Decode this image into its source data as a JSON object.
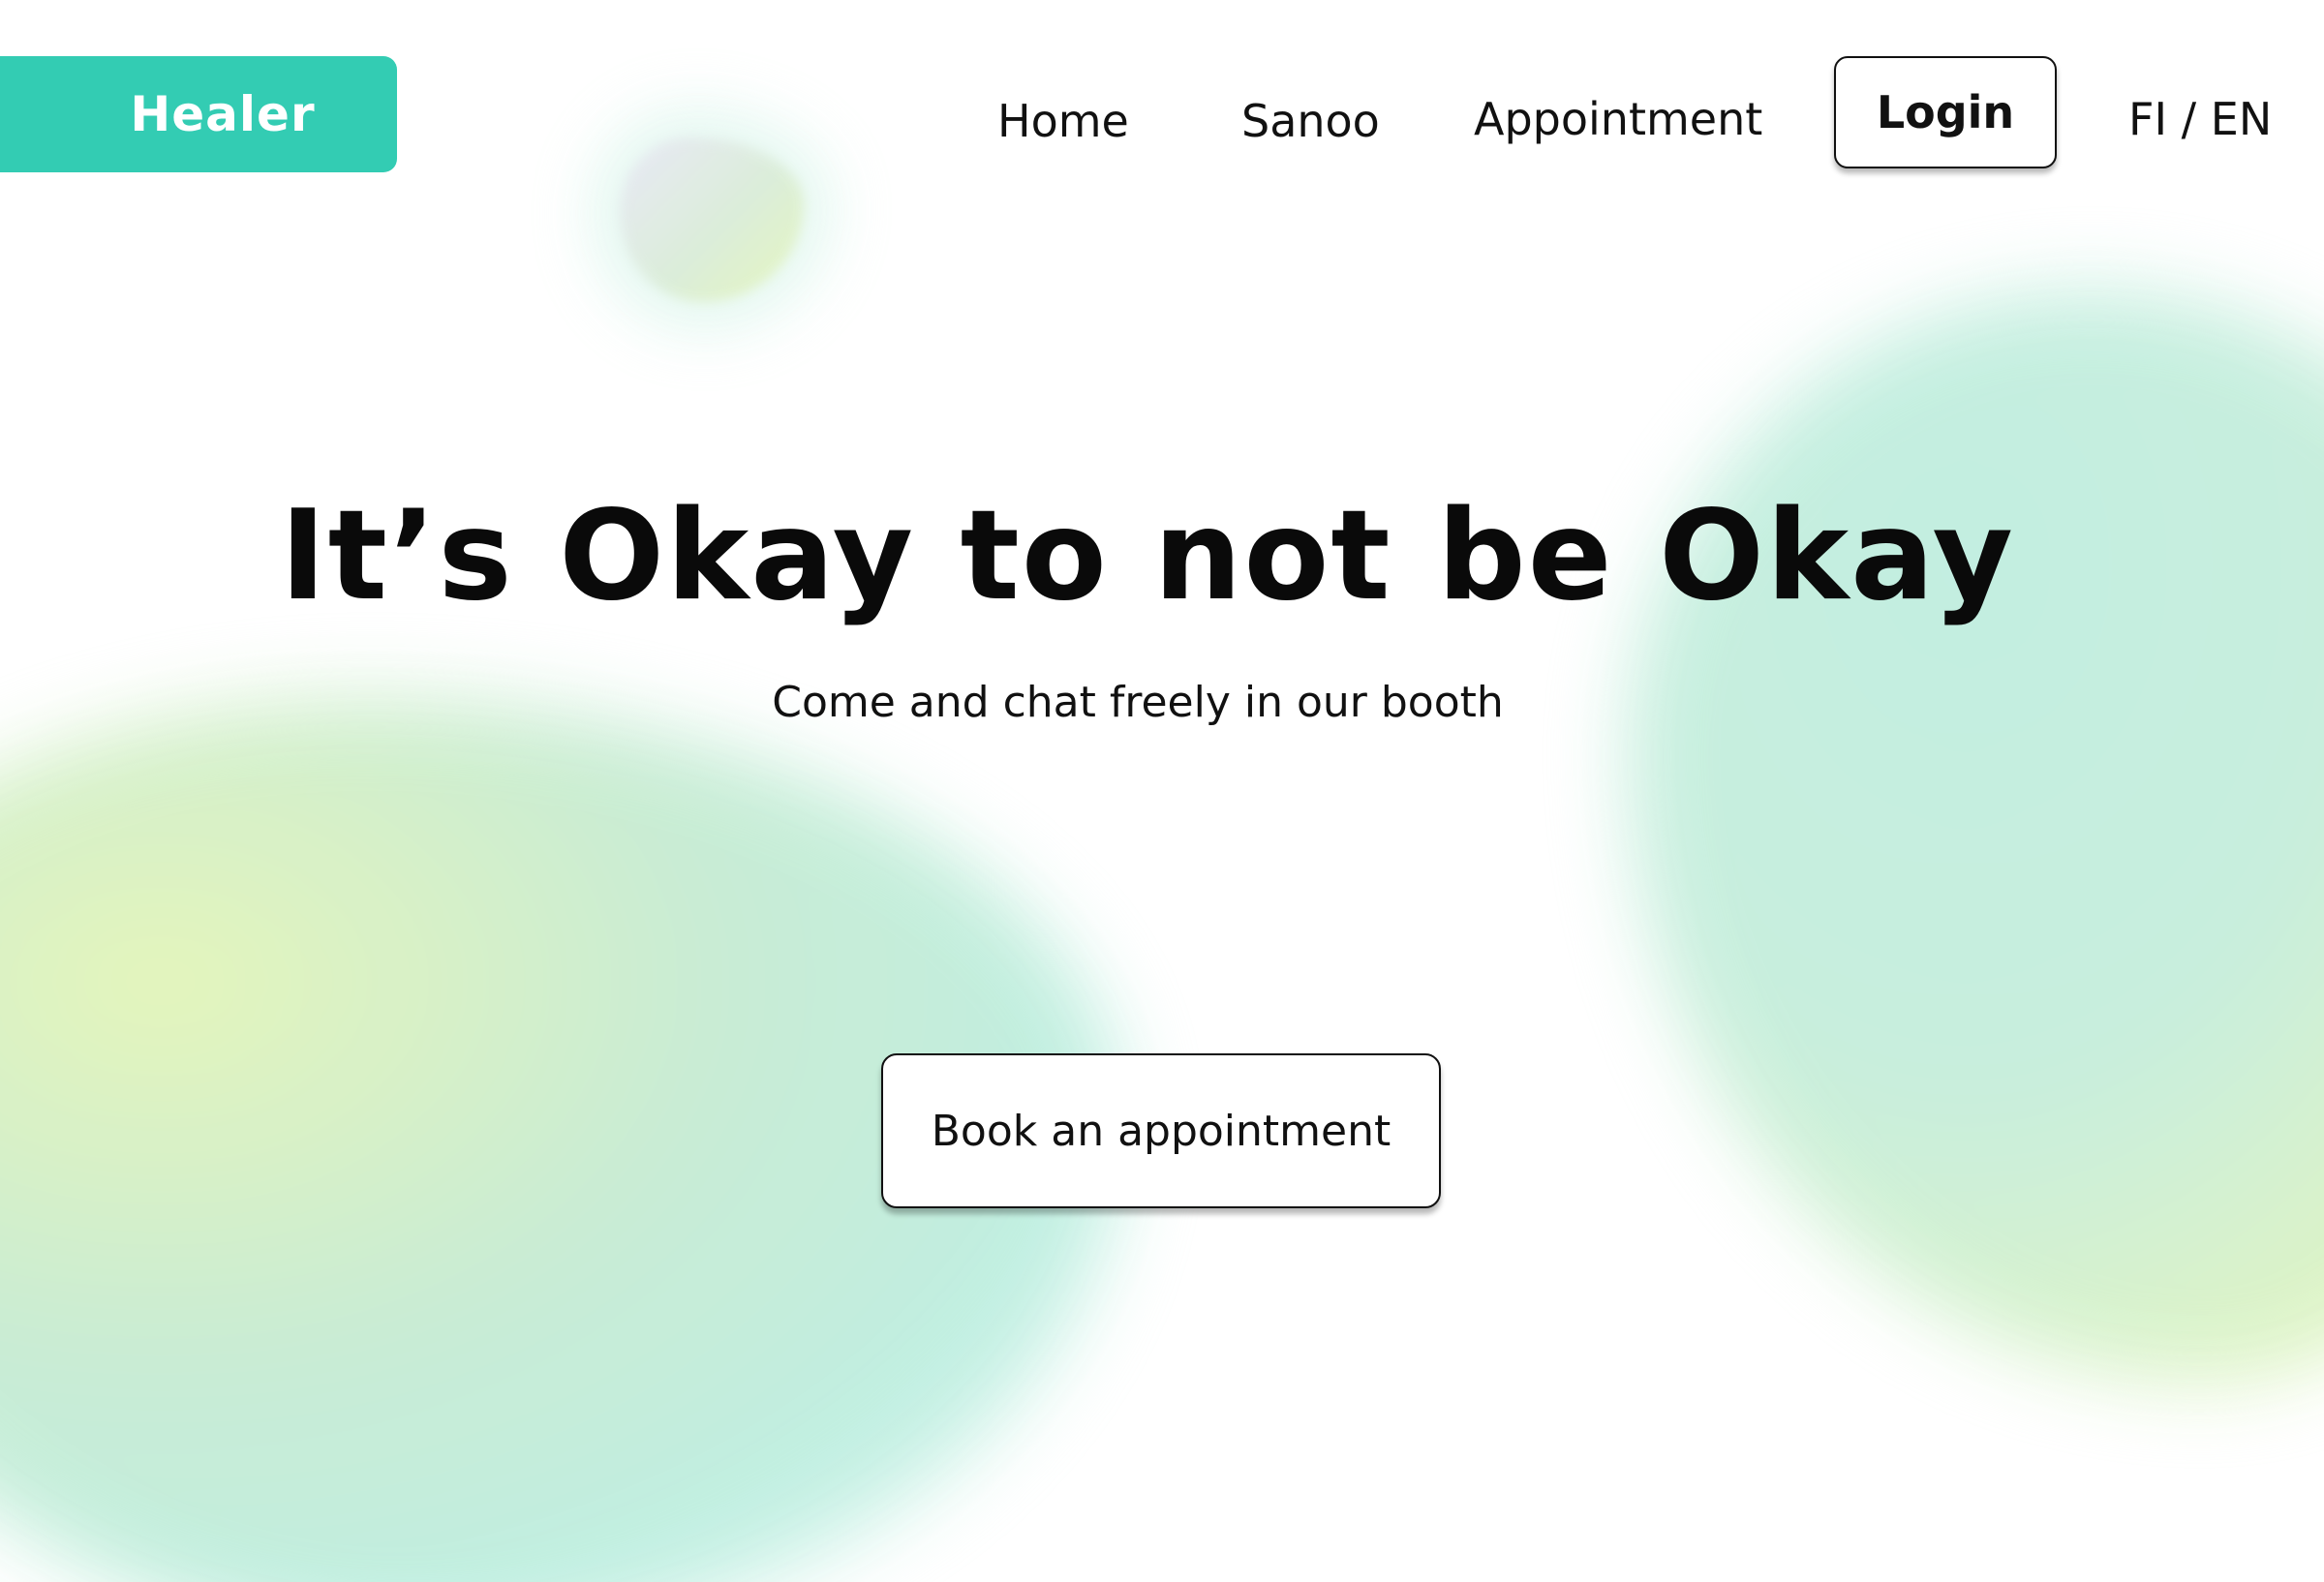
{
  "brand": {
    "name": "Healer",
    "accent_color": "#33ccb3"
  },
  "nav": {
    "items": [
      {
        "label": "Home"
      },
      {
        "label": "Sanoo"
      },
      {
        "label": "Appointment"
      }
    ],
    "login_label": "Login",
    "language_switch": "FI / EN"
  },
  "hero": {
    "headline": "It’s Okay to not be Okay",
    "subtitle": "Come and chat freely in our booth",
    "cta_label": "Book an appointment"
  }
}
